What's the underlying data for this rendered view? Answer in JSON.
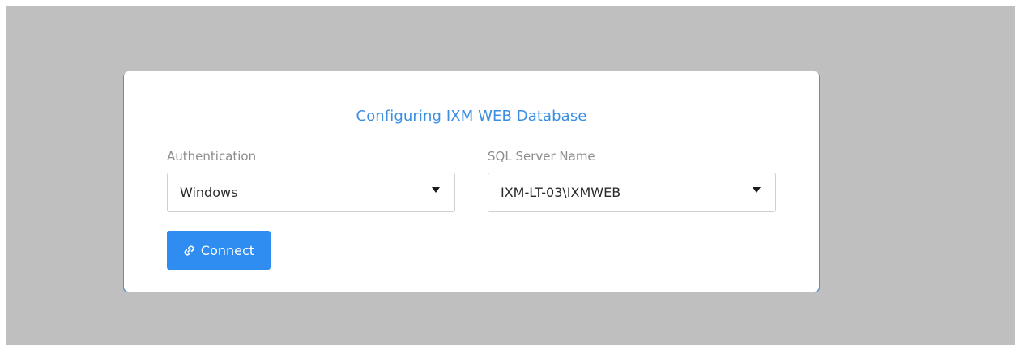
{
  "dialog": {
    "title": "Configuring IXM WEB Database"
  },
  "form": {
    "authentication": {
      "label": "Authentication",
      "value": "Windows"
    },
    "sql_server": {
      "label": "SQL Server Name",
      "value": "IXM-LT-03\\IXMWEB"
    }
  },
  "actions": {
    "connect_label": "Connect",
    "connect_icon": "link-icon"
  },
  "colors": {
    "accent": "#2f8cf0",
    "title": "#3b8fe3",
    "backdrop": "#bfbfbf"
  }
}
